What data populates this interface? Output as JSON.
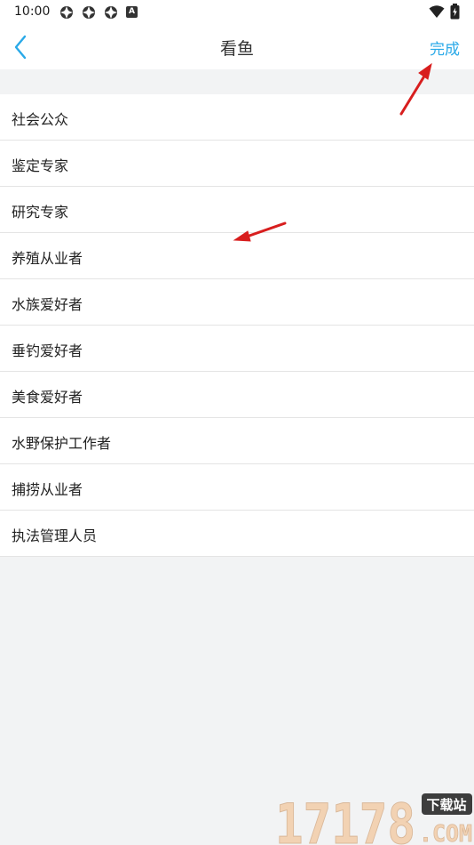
{
  "status_bar": {
    "time": "10:00",
    "letter_icon": "A",
    "icons": [
      "app-status-icon",
      "app-status-icon",
      "app-status-icon",
      "letter-a-icon",
      "wifi-icon",
      "battery-icon"
    ]
  },
  "header": {
    "title": "看鱼",
    "back_icon": "chevron-left-icon",
    "done_label": "完成",
    "accent_color": "#29a9e8"
  },
  "roles": [
    {
      "label": "社会公众"
    },
    {
      "label": "鉴定专家"
    },
    {
      "label": "研究专家"
    },
    {
      "label": "养殖从业者"
    },
    {
      "label": "水族爱好者"
    },
    {
      "label": "垂钓爱好者"
    },
    {
      "label": "美食爱好者"
    },
    {
      "label": "水野保护工作者"
    },
    {
      "label": "捕捞从业者"
    },
    {
      "label": "执法管理人员"
    }
  ],
  "annotation_color": "#d81e1e",
  "watermark": {
    "number": "17178",
    "badge": "下载站",
    "domain": ".COM"
  }
}
